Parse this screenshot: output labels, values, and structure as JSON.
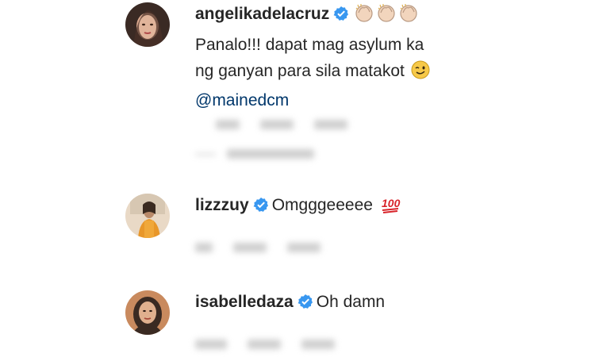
{
  "comments": [
    {
      "username": "angelikadelacruz",
      "emoji_line1": [
        "clapping-hands",
        "clapping-hands",
        "clapping-hands"
      ],
      "text_line1": "Panalo!!! dapat mag asylum ka",
      "text_line2": "ng ganyan para sila matakot",
      "emoji_line2": "winking-face",
      "mention": "@mainedcm",
      "meta": {
        "time": "",
        "likes": "",
        "reply": ""
      },
      "view_replies": ""
    },
    {
      "username": "lizzzuy",
      "text_line1": "Omgggeeeee",
      "emoji_line1": "hundred-points",
      "meta": {
        "time": "",
        "likes": "",
        "reply": ""
      }
    },
    {
      "username": "isabelledaza",
      "text_line1": "Oh damn",
      "meta": {
        "time": "",
        "likes": "",
        "reply": ""
      }
    }
  ],
  "colors": {
    "text": "#262626",
    "mention": "#00376b",
    "verified": "#3897f0",
    "meta": "#8e8e8e"
  }
}
